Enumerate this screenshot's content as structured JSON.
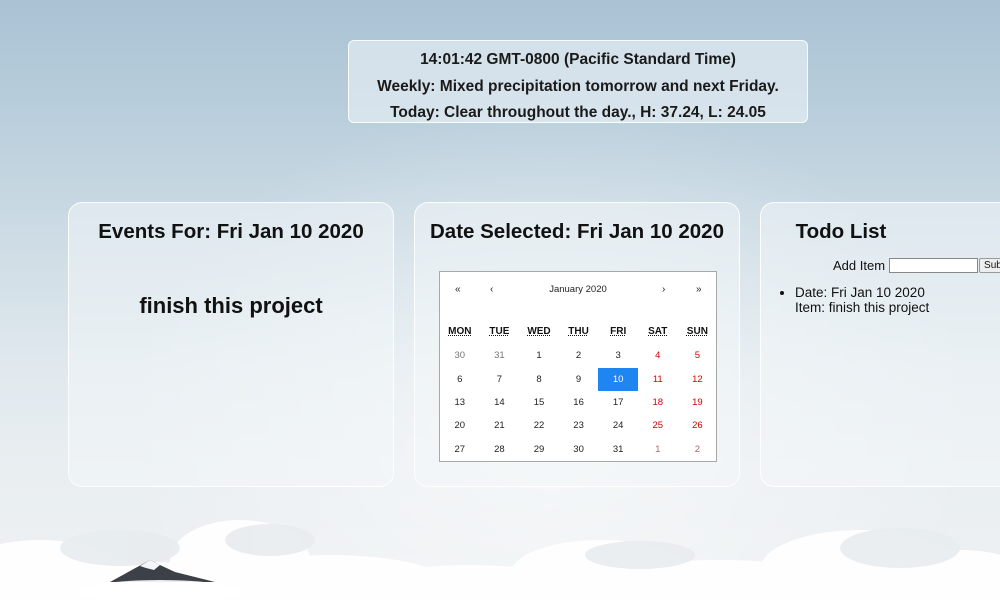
{
  "weather": {
    "time": "14:01:42 GMT-0800 (Pacific Standard Time)",
    "weekly": "Weekly: Mixed precipitation tomorrow and next Friday.",
    "today": "Today: Clear throughout the day., H: 37.24, L: 24.05"
  },
  "events": {
    "title": "Events For: Fri Jan 10 2020",
    "items": [
      "finish this project"
    ]
  },
  "calendar": {
    "title": "Date Selected: Fri Jan 10 2020",
    "month_label": "January 2020",
    "nav": {
      "prev_year": "«",
      "prev_month": "‹",
      "next_month": "›",
      "next_year": "»"
    },
    "weekdays": [
      "MON",
      "TUE",
      "WED",
      "THU",
      "FRI",
      "SAT",
      "SUN"
    ],
    "weeks": [
      [
        "30",
        "31",
        "1",
        "2",
        "3",
        "4",
        "5"
      ],
      [
        "6",
        "7",
        "8",
        "9",
        "10",
        "11",
        "12"
      ],
      [
        "13",
        "14",
        "15",
        "16",
        "17",
        "18",
        "19"
      ],
      [
        "20",
        "21",
        "22",
        "23",
        "24",
        "25",
        "26"
      ],
      [
        "27",
        "28",
        "29",
        "30",
        "31",
        "1",
        "2"
      ]
    ],
    "selected_day": "10"
  },
  "todo": {
    "title": "Todo List",
    "add_label": "Add Item",
    "input_value": "",
    "submit_label": "Submit",
    "items": [
      {
        "date": "Date: Fri Jan 10 2020",
        "item": "Item: finish this project"
      }
    ]
  },
  "colors": {
    "selected_day": "#1e86f0",
    "weekend": "#d10000"
  }
}
